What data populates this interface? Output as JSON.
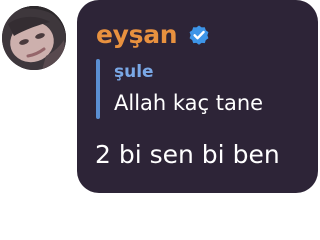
{
  "message": {
    "sender_name": "eyşan",
    "sender_verified_icon": "verified-badge-icon",
    "reply": {
      "author": "şule",
      "text": "Allah kaç tane"
    },
    "text": "2 bi sen bi ben"
  },
  "colors": {
    "bubble_background": "#2d2437",
    "sender_name": "#e8913f",
    "reply_bar": "#5b8fd2",
    "reply_author": "#7aa8e6",
    "verified_badge": "#3d95e8",
    "message_text": "#ffffff"
  }
}
